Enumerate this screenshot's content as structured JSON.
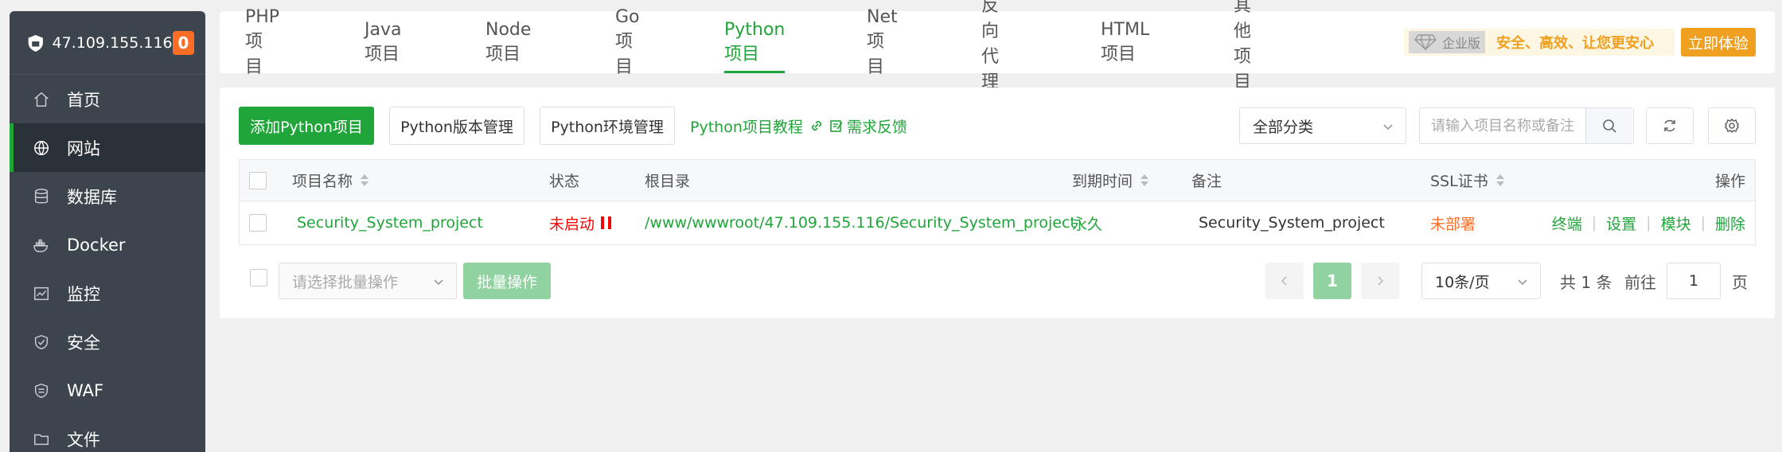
{
  "sidebar": {
    "server_ip": "47.109.155.116",
    "badge_count": "0",
    "items": [
      {
        "label": "首页",
        "icon": "home-icon"
      },
      {
        "label": "网站",
        "icon": "globe-icon",
        "active": true
      },
      {
        "label": "数据库",
        "icon": "database-icon"
      },
      {
        "label": "Docker",
        "icon": "docker-icon"
      },
      {
        "label": "监控",
        "icon": "monitor-icon"
      },
      {
        "label": "安全",
        "icon": "shield-icon"
      },
      {
        "label": "WAF",
        "icon": "waf-shield-icon"
      },
      {
        "label": "文件",
        "icon": "folder-icon"
      }
    ]
  },
  "topbar": {
    "tabs": [
      {
        "label": "PHP项目"
      },
      {
        "label": "Java项目"
      },
      {
        "label": "Node项目"
      },
      {
        "label": "Go项目"
      },
      {
        "label": "Python项目",
        "active": true
      },
      {
        "label": "Net项目"
      },
      {
        "label": "反向代理"
      },
      {
        "label": "HTML项目"
      },
      {
        "label": "其他项目"
      }
    ],
    "promo_badge": "企业版",
    "promo_text": "安全、高效、让您更安心",
    "trial_button": "立即体验"
  },
  "toolbar": {
    "add_button": "添加Python项目",
    "version_button": "Python版本管理",
    "env_button": "Python环境管理",
    "tutorial_link": "Python项目教程",
    "feedback_link": "需求反馈",
    "category_select": "全部分类",
    "search_placeholder": "请输入项目名称或备注"
  },
  "table": {
    "headers": {
      "name": "项目名称",
      "status": "状态",
      "root": "根目录",
      "expire": "到期时间",
      "remark": "备注",
      "ssl": "SSL证书",
      "ops": "操作"
    },
    "rows": [
      {
        "name": "Security_System_project",
        "status": "未启动",
        "root": "/www/wwwroot/47.109.155.116/Security_System_project",
        "expire": "永久",
        "remark": "Security_System_project",
        "ssl": "未部署",
        "ops": [
          "终端",
          "设置",
          "模块",
          "删除"
        ]
      }
    ]
  },
  "footer": {
    "batch_select_placeholder": "请选择批量操作",
    "batch_button": "批量操作",
    "current_page": "1",
    "page_size": "10条/页",
    "total_text": "共 1 条",
    "goto_text": "前往",
    "goto_value": "1",
    "page_unit": "页"
  },
  "colors": {
    "accent": "#20a53a",
    "sidebar_bg": "#3c444d",
    "danger": "#ef0808",
    "warning": "#fc6d26",
    "promo": "#f0a020"
  }
}
